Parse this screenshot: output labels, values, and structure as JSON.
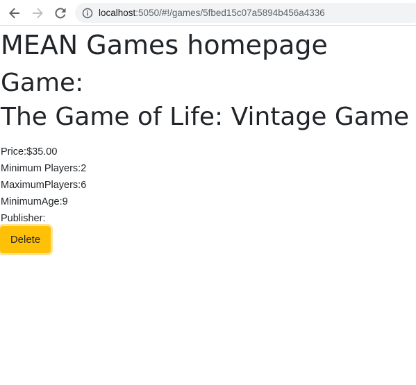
{
  "browser": {
    "url_host": "localhost",
    "url_rest": ":5050/#!/games/5fbed15c07a5894b456a4336"
  },
  "page": {
    "site_heading": "MEAN Games homepage",
    "game_label": "Game:",
    "game_title": "The Game of Life: Vintage Game Collection",
    "details": {
      "price_label": "Price:",
      "price_value": "$35.00",
      "min_players_label": "Minimum Players:",
      "min_players_value": "2",
      "max_players_label": "MaximumPlayers:",
      "max_players_value": "6",
      "min_age_label": "MinimumAge:",
      "min_age_value": "9",
      "publisher_label": "Publisher:",
      "publisher_value": ""
    },
    "delete_label": "Delete"
  },
  "colors": {
    "delete_button": "#ffc107",
    "omnibox_bg": "#f1f3f4",
    "text": "#212529"
  },
  "icons": [
    "back-arrow-icon",
    "forward-arrow-icon",
    "reload-icon",
    "info-icon"
  ]
}
